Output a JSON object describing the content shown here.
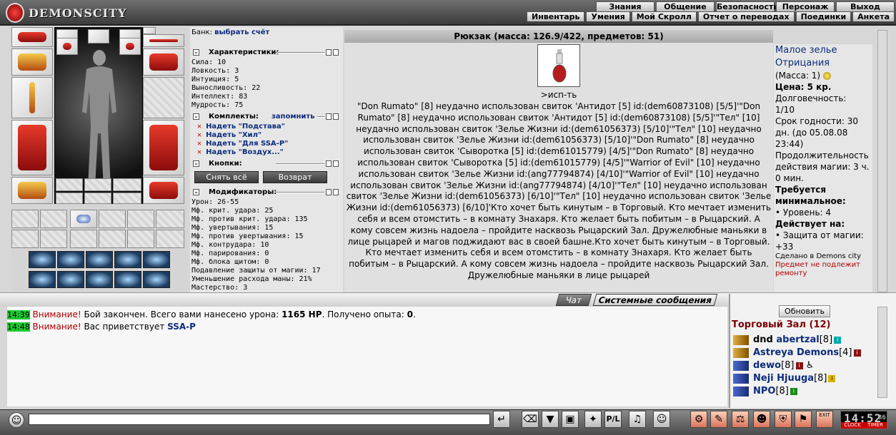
{
  "app": {
    "logo": "DEMONSCITY"
  },
  "nav": {
    "main": [
      "Знания",
      "Общение",
      "Безопасность",
      "Персонаж",
      "Выход"
    ],
    "sub": [
      "Инвентарь",
      "Умения",
      "Мой Скролл",
      "Отчет о переводах",
      "Поединки",
      "Анкета"
    ]
  },
  "colors": {
    "accent": "#0b2c7c",
    "warning": "#b00000",
    "timestamp_bg": "#1ec832",
    "room": "#7a0000"
  },
  "character": {
    "bank_label": "Банк:",
    "bank_link": "выбрать счёт",
    "stats_title": "Характеристики:",
    "stats": [
      "Сила: 10",
      "Ловкость: 3",
      "Интуиция: 5",
      "Выносливость: 22",
      "Интеллект: 83",
      "Мудрость: 75"
    ],
    "sets_title": "Комплекты:",
    "sets_remember": "запомнить",
    "sets": [
      "Надеть \"Подстава\"",
      "Надеть \"Хил\"",
      "Надеть \"Для SSA-P\"",
      "Надеть \"Воздух...\""
    ],
    "buttons_title": "Кнопки:",
    "btn_remove_all": "Снять всё",
    "btn_return": "Возврат",
    "mods_title": "Модификаторы:",
    "mods": [
      "Урон: 26-55",
      "Мф. крит. удара: 25",
      "Мф. против крит. удара: 135",
      "Мф. увертывания: 15",
      "Мф. против увертывания: 15",
      "Мф. контрудара: 10",
      "Мф. парирования: 0",
      "Мф. блока щитом: 0",
      "Подавление защиты от магии: 17",
      "Уменьшение расхода маны: 21%",
      "Мастерство: 3"
    ]
  },
  "backpack": {
    "title": "Рюкзак (масса: 126.9/422, предметов: 51)",
    "action": ">исп-ть",
    "log": "\"Don Rumato\" [8] неудачно использован свиток 'Антидот [5] id:(dem60873108) [5/5]'\"Don Rumato\" [8] неудачно использован свиток 'Антидот [5] id:(dem60873108) [5/5]'\"Тел\" [10] неудачно использован свиток 'Зелье Жизни id:(dem61056373) [5/10]'\"Тел\" [10] неудачно использован свиток 'Зелье Жизни id:(dem61056373) [5/10]'\"Don Rumato\" [8] неудачно использован свиток 'Сыворотка [5] id:(dem61015779) [4/5]'\"Don Rumato\" [8] неудачно использован свиток 'Сыворотка [5] id:(dem61015779) [4/5]'\"Warrior of Evil\" [10] неудачно использован свиток 'Зелье Жизни id:(ang77794874) [4/10]'\"Warrior of Evil\" [10] неудачно использован свиток 'Зелье Жизни id:(ang77794874) [4/10]'\"Тел\" [10] неудачно использован свиток 'Зелье Жизни id:(dem61056373) [6/10]'\"Тел\" [10] неудачно использован свиток 'Зелье Жизни id:(dem61056373) [6/10]'Кто хочет быть кинутым – в Торговый. Кто мечтает изменить себя и всем отомстить – в комнату Знахаря. Кто желает быть побитым – в Рыцарский. А кому совсем жизнь надоела – пройдите насквозь Рыцарский Зал. Дружелюбные маньяки в лице рыцарей и магов поджидают вас в своей башне.Кто хочет быть кинутым – в Торговый. Кто мечтает изменить себя и всем отомстить – в комнату Знахаря. Кто желает быть побитым – в Рыцарский. А кому совсем жизнь надоела – пройдите насквозь Рыцарский Зал. Дружелюбные маньяки в лице рыцарей"
  },
  "item": {
    "name": "Малое зелье Отрицания",
    "mass": "(Масса: 1)",
    "price": "Цена: 5 кр.",
    "durability_label": "Долговечность:",
    "durability": "1/10",
    "expiry": "Срок годности: 30 дн. (до 05.08.08 23:44)",
    "duration": "Продолжительность действия магии: 3 ч. 0 мин.",
    "req_title": "Требуется минимальное:",
    "req": "• Уровень: 4",
    "effect_title": "Действует на:",
    "effect": "• Защита от магии: +33",
    "made_in": "Сделано в Demons city",
    "no_repair": "Предмет не подлежит ремонту"
  },
  "chat": {
    "tab_chat": "Чат",
    "tab_system": "Системные сообщения",
    "messages": [
      {
        "time": "14:39",
        "prefix": "Внимание!",
        "text1": " Бой закончен. Всего вами нанесено урона: ",
        "hp": "1165 HP",
        "text2": ". Получено опыта: ",
        "exp": "0",
        "text3": "."
      },
      {
        "time": "14:48",
        "prefix": "Внимание!",
        "text1": " Вас приветствует ",
        "guild": "SSA-P"
      }
    ]
  },
  "users": {
    "refresh": "Обновить",
    "room": "Торговый Зал (12)",
    "list": [
      {
        "prefix": "dnd ",
        "name": "abertzal",
        "level": "[8]"
      },
      {
        "prefix": "",
        "name": "Astreya Demons",
        "level": "[4]"
      },
      {
        "prefix": "",
        "name": "dewo",
        "level": "[8]"
      },
      {
        "prefix": "",
        "name": "Neji Hjuuga",
        "level": "[8]"
      },
      {
        "prefix": "",
        "name": "NPO",
        "level": "[8]"
      }
    ]
  },
  "footer": {
    "clock": "14:52",
    "seconds": "36",
    "clock_label": "CLOCK",
    "timer_label": "TIMER",
    "exit_label": "EXIT"
  }
}
